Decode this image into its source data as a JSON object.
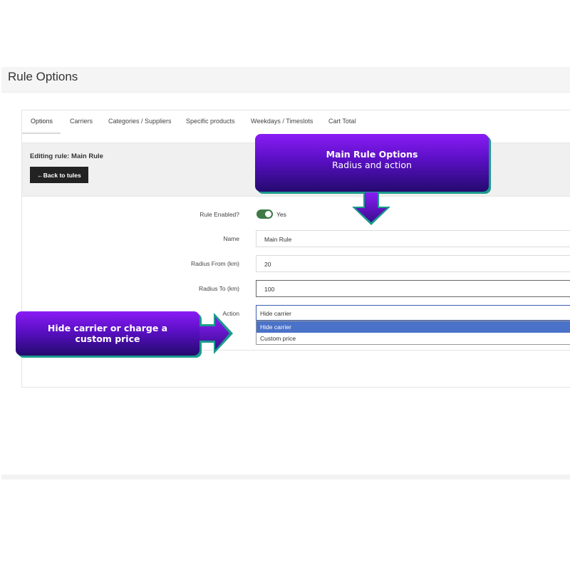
{
  "page": {
    "title": "Rule Options"
  },
  "tabs": [
    {
      "label": "Options"
    },
    {
      "label": "Carriers"
    },
    {
      "label": "Categories / Suppliers"
    },
    {
      "label": "Specific products"
    },
    {
      "label": "Weekdays / Timeslots"
    },
    {
      "label": "Cart Total"
    }
  ],
  "editing": {
    "title": "Editing rule: Main Rule",
    "back_label": "←Back to tules"
  },
  "form": {
    "enabled": {
      "label": "Rule Enabled?",
      "value_text": "Yes"
    },
    "name": {
      "label": "Name",
      "value": "Main Rule"
    },
    "radius_from": {
      "label": "Radius From (km)",
      "value": "20"
    },
    "radius_to": {
      "label": "Radius To (km)",
      "value": "100"
    },
    "action": {
      "label": "Action",
      "selected": "Hide carrier",
      "options": [
        "Hide carrier",
        "Custom price"
      ]
    }
  },
  "callouts": {
    "main": {
      "title": "Main Rule Options",
      "subtitle": "Radius and action"
    },
    "action": {
      "line1": "Hide carrier or charge a",
      "line2": "custom price"
    }
  },
  "colors": {
    "callout_gradient_top": "#8a1cf5",
    "callout_gradient_bottom": "#240a6e",
    "callout_border": "#1a9a8c",
    "toggle_on": "#3d7a45",
    "select_highlight": "#4a72c9",
    "back_button": "#222222"
  },
  "icons": {
    "toggle": "toggle-switch-icon",
    "arrow_down": "arrow-down-icon",
    "arrow_right": "arrow-right-icon"
  }
}
